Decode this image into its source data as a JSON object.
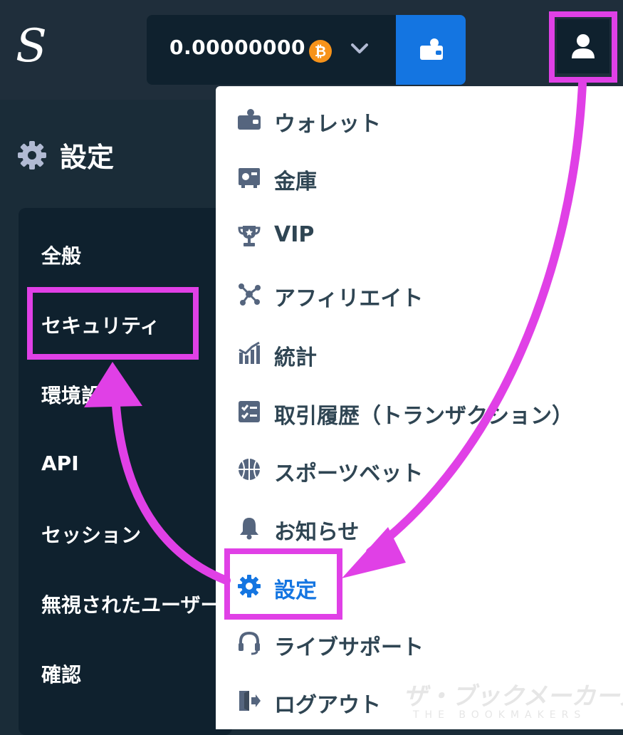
{
  "header": {
    "logo_text": "S",
    "balance": "0.00000000",
    "currency_symbol": "₿"
  },
  "settings": {
    "title": "設定"
  },
  "sidebar": {
    "items": [
      {
        "label": "全般"
      },
      {
        "label": "セキュリティ"
      },
      {
        "label": "環境設定"
      },
      {
        "label": "API"
      },
      {
        "label": "セッション"
      },
      {
        "label": "無視されたユーザー"
      },
      {
        "label": "確認"
      }
    ]
  },
  "menu": {
    "items": [
      {
        "label": "ウォレット",
        "icon": "wallet-icon"
      },
      {
        "label": "金庫",
        "icon": "vault-icon"
      },
      {
        "label": "VIP",
        "icon": "trophy-icon"
      },
      {
        "label": "アフィリエイト",
        "icon": "affiliate-icon"
      },
      {
        "label": "統計",
        "icon": "stats-icon"
      },
      {
        "label": "取引履歴（トランザクション）",
        "icon": "transactions-icon"
      },
      {
        "label": "スポーツベット",
        "icon": "sportsbook-icon"
      },
      {
        "label": "お知らせ",
        "icon": "bell-icon"
      },
      {
        "label": "設定",
        "icon": "gear-icon"
      },
      {
        "label": "ライブサポート",
        "icon": "headset-icon"
      },
      {
        "label": "ログアウト",
        "icon": "logout-icon"
      }
    ]
  },
  "watermark": {
    "text": "ザ・ブックメーカーズ",
    "sub": "THE BOOKMAKERS"
  },
  "colors": {
    "accent": "#1475e1",
    "highlight": "#e040e6",
    "background": "#1a2c38",
    "menu_text": "#2f4553"
  }
}
